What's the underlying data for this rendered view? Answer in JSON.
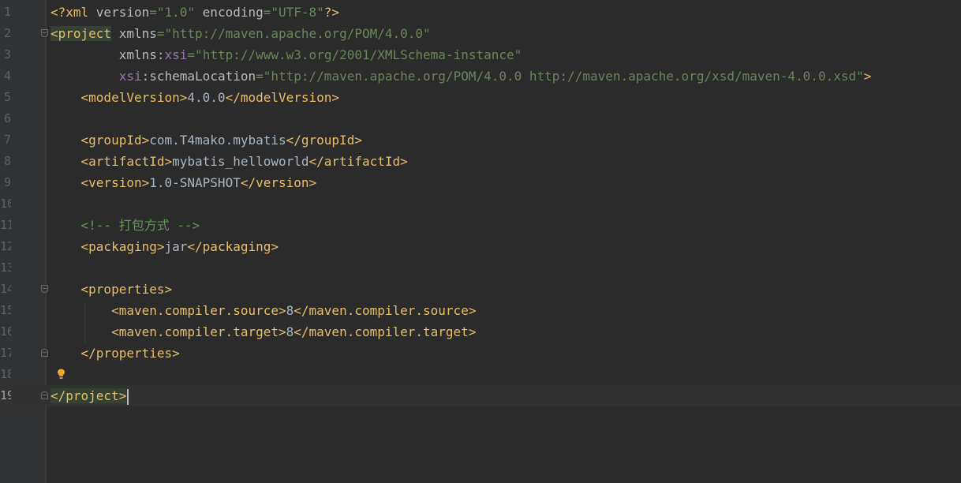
{
  "editor": {
    "language": "xml",
    "colors": {
      "background": "#2b2b2b",
      "gutter": "#313335",
      "tag": "#e8bf6a",
      "attribute": "#bababa",
      "namespace": "#9876aa",
      "string": "#6a8759",
      "text": "#a9b7c6",
      "comment": "#629755"
    },
    "lines": [
      {
        "num": "1",
        "tokens": [
          [
            "t-tag",
            "<?xml "
          ],
          [
            "t-attr",
            "version"
          ],
          [
            "t-str",
            "=\"1.0\" "
          ],
          [
            "t-attr",
            "encoding"
          ],
          [
            "t-str",
            "=\"UTF-8\""
          ],
          [
            "t-tag",
            "?>"
          ]
        ]
      },
      {
        "num": "2",
        "fold": "start",
        "tokens": [
          [
            "t-tag t-hl",
            "<project"
          ],
          [
            "t-txt",
            " "
          ],
          [
            "t-attr",
            "xmlns"
          ],
          [
            "t-str",
            "=\"http://maven.apache.org/POM/4.0.0\""
          ]
        ]
      },
      {
        "num": "3",
        "tokens": [
          [
            "t-txt",
            "         "
          ],
          [
            "t-attr",
            "xmlns"
          ],
          [
            "t-txt",
            ":"
          ],
          [
            "t-ns",
            "xsi"
          ],
          [
            "t-str",
            "=\"http://www.w3.org/2001/XMLSchema-instance\""
          ]
        ]
      },
      {
        "num": "4",
        "tokens": [
          [
            "t-txt",
            "         "
          ],
          [
            "t-ns",
            "xsi"
          ],
          [
            "t-txt",
            ":"
          ],
          [
            "t-attr",
            "schemaLocation"
          ],
          [
            "t-str",
            "=\"http://maven.apache.org/POM/4.0.0 http://maven.apache.org/xsd/maven-4.0.0.xsd\""
          ],
          [
            "t-tag",
            ">"
          ]
        ]
      },
      {
        "num": "5",
        "tokens": [
          [
            "t-txt",
            "    "
          ],
          [
            "t-tag",
            "<modelVersion>"
          ],
          [
            "t-txt",
            "4.0.0"
          ],
          [
            "t-tag",
            "</modelVersion>"
          ]
        ]
      },
      {
        "num": "6",
        "tokens": []
      },
      {
        "num": "7",
        "tokens": [
          [
            "t-txt",
            "    "
          ],
          [
            "t-tag",
            "<groupId>"
          ],
          [
            "t-txt",
            "com.T4mako.mybatis"
          ],
          [
            "t-tag",
            "</groupId>"
          ]
        ]
      },
      {
        "num": "8",
        "tokens": [
          [
            "t-txt",
            "    "
          ],
          [
            "t-tag",
            "<artifactId>"
          ],
          [
            "t-txt",
            "mybatis_helloworld"
          ],
          [
            "t-tag",
            "</artifactId>"
          ]
        ]
      },
      {
        "num": "9",
        "tokens": [
          [
            "t-txt",
            "    "
          ],
          [
            "t-tag",
            "<version>"
          ],
          [
            "t-txt",
            "1.0-SNAPSHOT"
          ],
          [
            "t-tag",
            "</version>"
          ]
        ]
      },
      {
        "num": "10",
        "tokens": []
      },
      {
        "num": "11",
        "tokens": [
          [
            "t-txt",
            "    "
          ],
          [
            "t-cmt",
            "<!-- 打包方式 -->"
          ]
        ]
      },
      {
        "num": "12",
        "tokens": [
          [
            "t-txt",
            "    "
          ],
          [
            "t-tag",
            "<packaging>"
          ],
          [
            "t-txt",
            "jar"
          ],
          [
            "t-tag",
            "</packaging>"
          ]
        ]
      },
      {
        "num": "13",
        "tokens": []
      },
      {
        "num": "14",
        "fold": "start",
        "tokens": [
          [
            "t-txt",
            "    "
          ],
          [
            "t-tag",
            "<properties>"
          ]
        ]
      },
      {
        "num": "15",
        "tokens": [
          [
            "t-txt",
            "        "
          ],
          [
            "t-tag",
            "<maven.compiler.source>"
          ],
          [
            "t-txt",
            "8"
          ],
          [
            "t-tag",
            "</maven.compiler.source>"
          ]
        ]
      },
      {
        "num": "16",
        "tokens": [
          [
            "t-txt",
            "        "
          ],
          [
            "t-tag",
            "<maven.compiler.target>"
          ],
          [
            "t-txt",
            "8"
          ],
          [
            "t-tag",
            "</maven.compiler.target>"
          ]
        ]
      },
      {
        "num": "17",
        "fold": "end",
        "tokens": [
          [
            "t-txt",
            "    "
          ],
          [
            "t-tag",
            "</properties>"
          ]
        ]
      },
      {
        "num": "18",
        "bulb": true,
        "tokens": []
      },
      {
        "num": "19",
        "fold": "end",
        "current": true,
        "caret": true,
        "tokens": [
          [
            "t-tag t-hl",
            "</project>"
          ]
        ]
      }
    ]
  }
}
